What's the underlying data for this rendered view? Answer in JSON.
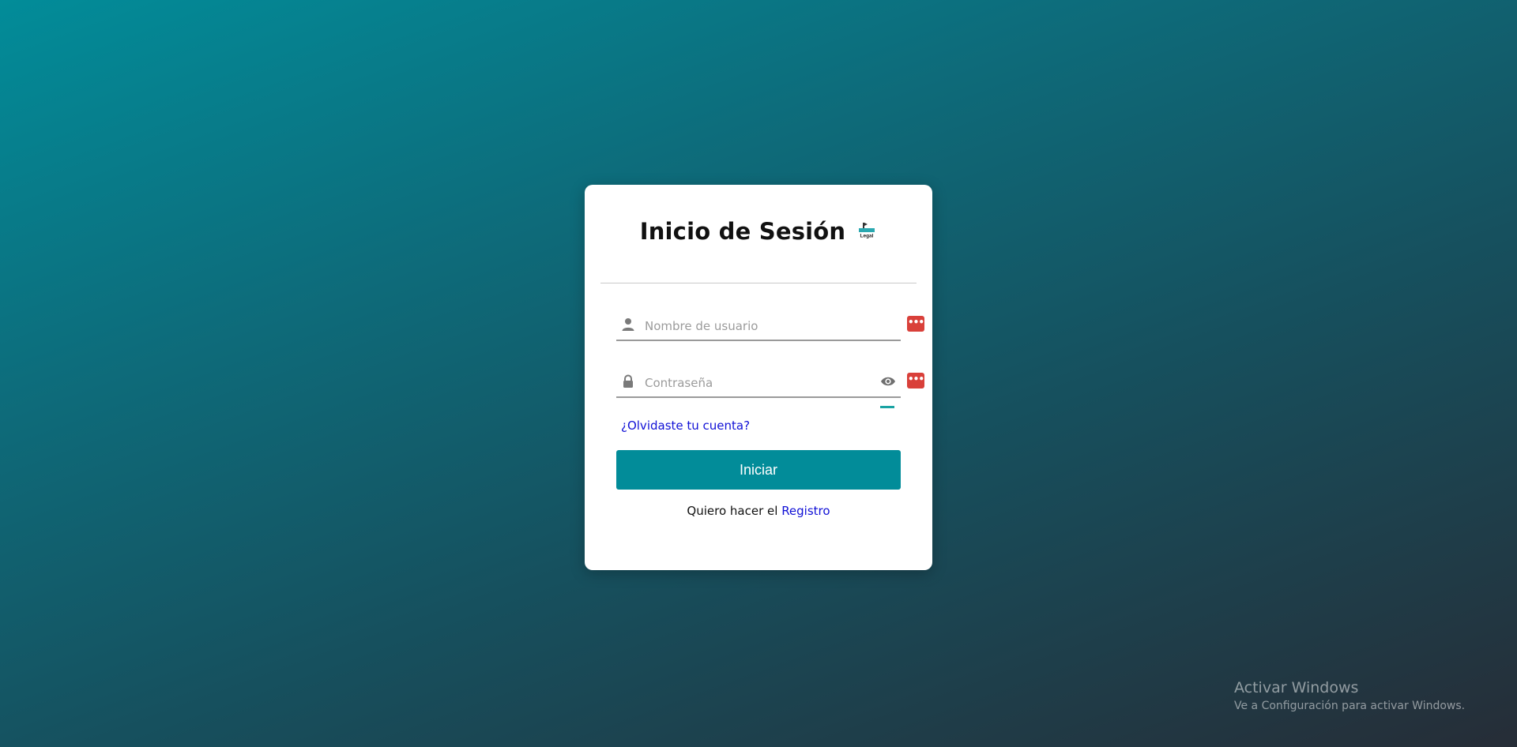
{
  "login": {
    "title": "Inicio de Sesión",
    "username_placeholder": "Nombre de usuario",
    "password_placeholder": "Contraseña",
    "forgot_link": "¿Olvidaste tu cuenta?",
    "submit_label": "Iniciar",
    "register_prompt": "Quiero hacer el",
    "register_link": "Registro"
  },
  "icons": {
    "logo": "legal-logo-icon",
    "user": "person-icon",
    "lock": "lock-icon",
    "eye": "eye-icon",
    "extension_badge": "password-manager-icon"
  },
  "extension_badge_text": "•••",
  "colors": {
    "accent": "#028c99",
    "link": "#1010d6",
    "badge": "#d9403a"
  },
  "watermark": {
    "title": "Activar Windows",
    "subtitle": "Ve a Configuración para activar Windows."
  }
}
